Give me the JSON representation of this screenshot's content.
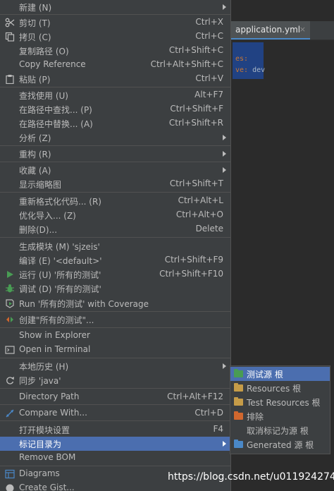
{
  "editor": {
    "tab_label": "application.yml",
    "tab_close": "×",
    "code_line1": "es:",
    "code_line2_key": "ve:",
    "code_line2_val": " dev"
  },
  "watermark": "https://blog.csdn.net/u011924274",
  "menu": {
    "new": {
      "label": "新建 (N)"
    },
    "cut": {
      "label": "剪切 (T)",
      "shortcut": "Ctrl+X"
    },
    "copy": {
      "label": "拷贝 (C)",
      "shortcut": "Ctrl+C"
    },
    "copy_path": {
      "label": "复制路径 (O)",
      "shortcut": "Ctrl+Shift+C"
    },
    "copy_reference": {
      "label": "Copy Reference",
      "shortcut": "Ctrl+Alt+Shift+C"
    },
    "paste": {
      "label": "粘贴 (P)",
      "shortcut": "Ctrl+V"
    },
    "find_usages": {
      "label": "查找使用 (U)",
      "shortcut": "Alt+F7"
    },
    "find_in_path": {
      "label": "在路径中查找... (P)",
      "shortcut": "Ctrl+Shift+F"
    },
    "replace_in_path": {
      "label": "在路径中替换... (A)",
      "shortcut": "Ctrl+Shift+R"
    },
    "analyze": {
      "label": "分析 (Z)"
    },
    "refactor": {
      "label": "重构 (R)"
    },
    "favorites": {
      "label": "收藏 (A)"
    },
    "thumbnails": {
      "label": "显示缩略图",
      "shortcut": "Ctrl+Shift+T"
    },
    "reformat": {
      "label": "重新格式化代码... (R)",
      "shortcut": "Ctrl+Alt+L"
    },
    "optimize_imports": {
      "label": "优化导入... (Z)",
      "shortcut": "Ctrl+Alt+O"
    },
    "delete": {
      "label": "删除(D)...",
      "shortcut": "Delete"
    },
    "build_module": {
      "label": "生成模块 (M) 'sjzeis'"
    },
    "compile": {
      "label": "编译 (E) '<default>'",
      "shortcut": "Ctrl+Shift+F9"
    },
    "run": {
      "label": "运行 (U) '所有的测试'",
      "shortcut": "Ctrl+Shift+F10"
    },
    "debug": {
      "label": "调试 (D) '所有的测试'"
    },
    "run_coverage": {
      "label": "Run '所有的测试' with Coverage"
    },
    "create": {
      "label": "创建\"所有的测试\"..."
    },
    "show_explorer": {
      "label": "Show in Explorer"
    },
    "open_terminal": {
      "label": "Open in Terminal"
    },
    "local_history": {
      "label": "本地历史 (H)"
    },
    "sync": {
      "label": "同步 'java'"
    },
    "directory_path": {
      "label": "Directory Path",
      "shortcut": "Ctrl+Alt+F12"
    },
    "compare_with": {
      "label": "Compare With...",
      "shortcut": "Ctrl+D"
    },
    "module_settings": {
      "label": "打开模块设置",
      "shortcut": "F4"
    },
    "mark_directory": {
      "label": "标记目录为"
    },
    "remove_bom": {
      "label": "Remove BOM"
    },
    "diagrams": {
      "label": "Diagrams"
    },
    "create_gist": {
      "label": "Create Gist..."
    }
  },
  "submenu": {
    "test_sources_root": {
      "label": "测试源 根",
      "color": "#499c54"
    },
    "resources_root": {
      "label": "Resources 根",
      "color": "#c69c48"
    },
    "test_resources_root": {
      "label": "Test Resources 根",
      "color": "#c69c48"
    },
    "excluded": {
      "label": "排除",
      "color": "#d0672e"
    },
    "unmark": {
      "label": "取消标记为源 根"
    },
    "generated_sources_root": {
      "label": "Generated 源 根",
      "color": "#4a88c7"
    }
  }
}
